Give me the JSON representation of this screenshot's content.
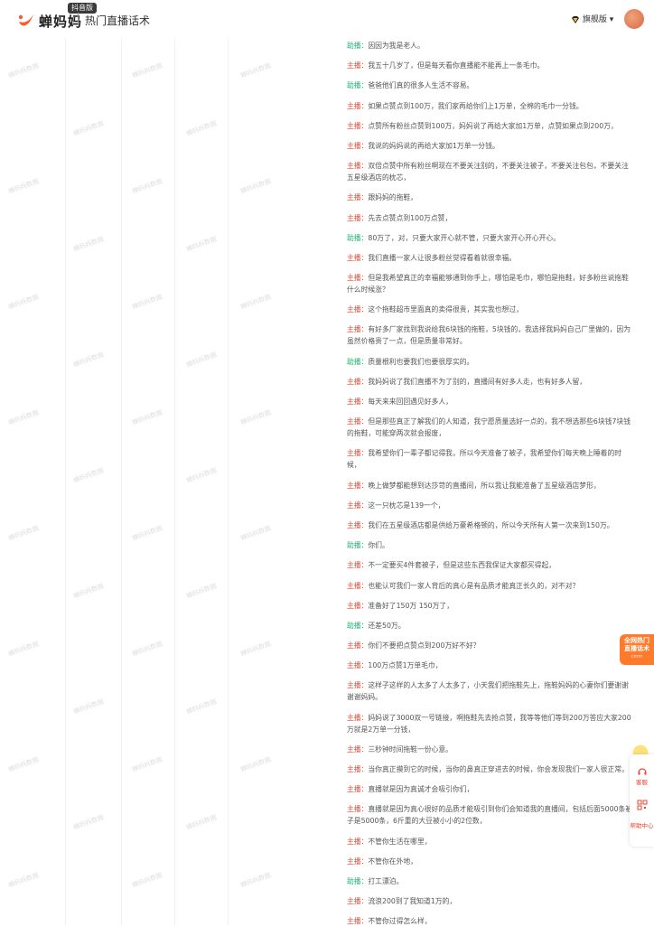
{
  "header": {
    "brand": "蝉妈妈",
    "badge": "抖音版",
    "page_title": "热门直播话术",
    "user_label": "旗舰版"
  },
  "watermark_text": "蝉妈妈数据",
  "speakers": {
    "host": "主播：",
    "assistant": "助播："
  },
  "transcript": [
    {
      "role": "assistant",
      "text": "因因为我是老人。"
    },
    {
      "role": "host",
      "text": "我五十几岁了，但是每天看你直播能不能再上一条毛巾。"
    },
    {
      "role": "assistant",
      "text": "爸爸他们真的很多人生活不容易。"
    },
    {
      "role": "host",
      "text": "如果点赞点到100万，我们家再给你们上1万单，全棉的毛巾一分钱。"
    },
    {
      "role": "host",
      "text": "点赞所有粉丝点赞到100万，妈妈说了再给大家加1万单，点赞如果点到200万，"
    },
    {
      "role": "host",
      "text": "我说的妈妈说的再给大家加1万单一分钱。"
    },
    {
      "role": "host",
      "text": "双倍点赞中所有粉丝啊现在不要关注别的，不要关注被子，不要关注包包，不要关注五星级酒店的枕芯，"
    },
    {
      "role": "host",
      "text": "跟妈妈的拖鞋，"
    },
    {
      "role": "host",
      "text": "先去点赞点到100万点赞，"
    },
    {
      "role": "assistant",
      "text": "80万了，对，只要大家开心就不管，只要大家开心开心开心。"
    },
    {
      "role": "host",
      "text": "我们直播一家人让很多粉丝觉得看着就很幸福。"
    },
    {
      "role": "host",
      "text": "但是我希望真正的幸福能够通到你手上，哪怕是毛巾，哪怕是拖鞋，好多粉丝说拖鞋什么时候涨？"
    },
    {
      "role": "host",
      "text": "这个拖鞋超市里面真的卖得很贵，其实我也想过，"
    },
    {
      "role": "host",
      "text": "有好多厂家找到我说给我6块钱的拖鞋，5块钱的，我选择我妈妈自己厂里做的，因为虽然价格贵了一点，但是质量非常好。"
    },
    {
      "role": "assistant",
      "text": "质量根利也要我们也要很厚实的。"
    },
    {
      "role": "host",
      "text": "我妈妈说了我们直播不为了别的，直播间有好多人走，也有好多人留，"
    },
    {
      "role": "host",
      "text": "每天来来回回遇见好多人，"
    },
    {
      "role": "host",
      "text": "但是那些真正了解我们的人知道，我宁愿质量选好一点的，我不想选那些6块钱7块钱的拖鞋，可能穿两次就会报废，"
    },
    {
      "role": "host",
      "text": "我希望你们一辈子都记得我，所以今天准备了被子，我希望你们每天晚上睡着的时候，"
    },
    {
      "role": "host",
      "text": "晚上做梦都能想到达莎苛的直播间，所以我让我能准备了五星级酒店梦形，"
    },
    {
      "role": "host",
      "text": "这一只枕芯是139一个，"
    },
    {
      "role": "host",
      "text": "我们在五星级酒店都是供给万豪希格顿的，所以今天所有人第一次来到150万。"
    },
    {
      "role": "assistant",
      "text": "你们。"
    },
    {
      "role": "host",
      "text": "不一定要买4件套被子，但是这些东西我保证大家都买得起，"
    },
    {
      "role": "host",
      "text": "也能认可我们一家人背后的真心是有品质才能真正长久的，对不对？"
    },
    {
      "role": "host",
      "text": "准备好了150万 150万了，"
    },
    {
      "role": "assistant",
      "text": "还差50万。"
    },
    {
      "role": "host",
      "text": "你们不要把点赞点到200万好不好？"
    },
    {
      "role": "host",
      "text": "100万点赞1万单毛巾，"
    },
    {
      "role": "host",
      "text": "这样子这样的人太多了人太多了，小天我们把拖鞋先上，拖鞋妈妈的心妻你们要谢谢谢谢妈妈。"
    },
    {
      "role": "host",
      "text": "妈妈说了3000双一号链接，啊拖鞋先去抢点赞，我等等他们等到200万答应大家200万就是2万单一分钱，"
    },
    {
      "role": "host",
      "text": "三秒钟时间拖鞋一份心意。"
    },
    {
      "role": "host",
      "text": "当你真正摸到它的时候，当你的鼻真正穿进去的时候，你会发现我们一家人很正常。"
    },
    {
      "role": "host",
      "text": "直播就是因为真诚才会吸引你们，"
    },
    {
      "role": "host",
      "text": "直播就是因为真心很好的品质才能吸引到你们会知道我的直播间，包括后面5000条被子是5000条，6斤重的大豆被小小的2位数，"
    },
    {
      "role": "host",
      "text": "不管你生活在哪里，"
    },
    {
      "role": "host",
      "text": "不管你在外地，"
    },
    {
      "role": "assistant",
      "text": "打工漂泊。"
    },
    {
      "role": "host",
      "text": "流浪200到了我知道1万的，"
    },
    {
      "role": "host",
      "text": "不管你过得怎么样，"
    }
  ],
  "promo": {
    "line1": "全网热门",
    "line2": "直播话术",
    "sub": "cmm"
  },
  "side_panel": {
    "service": "客服",
    "help": "帮助中心"
  },
  "colors": {
    "host": "#e8452f",
    "assistant": "#1bb56d",
    "accent": "#ff7b2c"
  }
}
